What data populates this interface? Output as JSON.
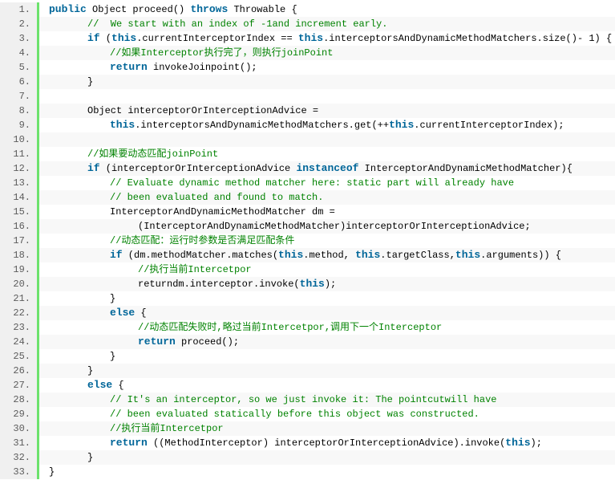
{
  "colors": {
    "keyword": "#006699",
    "comment": "#008200",
    "gutter_border": "#6ce26c",
    "line_number": "#5c5c5c"
  },
  "lines": [
    {
      "n": "1.",
      "indent": 0,
      "tokens": [
        [
          "kw",
          "public"
        ],
        [
          "t",
          " Object proceed() "
        ],
        [
          "kw",
          "throws"
        ],
        [
          "t",
          " Throwable {"
        ]
      ]
    },
    {
      "n": "2.",
      "indent": 1,
      "tokens": [
        [
          "cm",
          "//  We start with an index of -1and increment early."
        ]
      ]
    },
    {
      "n": "3.",
      "indent": 1,
      "tokens": [
        [
          "kw",
          "if"
        ],
        [
          "t",
          " ("
        ],
        [
          "kw",
          "this"
        ],
        [
          "t",
          ".currentInterceptorIndex == "
        ],
        [
          "kw",
          "this"
        ],
        [
          "t",
          ".interceptorsAndDynamicMethodMatchers.size()- 1) {"
        ]
      ]
    },
    {
      "n": "4.",
      "indent": 2,
      "tokens": [
        [
          "cm",
          "//如果Interceptor执行完了，则执行joinPoint"
        ]
      ]
    },
    {
      "n": "5.",
      "indent": 2,
      "tokens": [
        [
          "kw",
          "return"
        ],
        [
          "t",
          " invokeJoinpoint();"
        ]
      ]
    },
    {
      "n": "6.",
      "indent": 1,
      "tokens": [
        [
          "t",
          "}"
        ]
      ]
    },
    {
      "n": "7.",
      "indent": 0,
      "tokens": []
    },
    {
      "n": "8.",
      "indent": 1,
      "tokens": [
        [
          "t",
          "Object interceptorOrInterceptionAdvice ="
        ]
      ]
    },
    {
      "n": "9.",
      "indent": 2,
      "tokens": [
        [
          "kw",
          "this"
        ],
        [
          "t",
          ".interceptorsAndDynamicMethodMatchers.get(++"
        ],
        [
          "kw",
          "this"
        ],
        [
          "t",
          ".currentInterceptorIndex);"
        ]
      ]
    },
    {
      "n": "10.",
      "indent": 0,
      "tokens": []
    },
    {
      "n": "11.",
      "indent": 1,
      "tokens": [
        [
          "cm",
          "//如果要动态匹配joinPoint"
        ]
      ]
    },
    {
      "n": "12.",
      "indent": 1,
      "tokens": [
        [
          "kw",
          "if"
        ],
        [
          "t",
          " (interceptorOrInterceptionAdvice "
        ],
        [
          "kw",
          "instanceof"
        ],
        [
          "t",
          " InterceptorAndDynamicMethodMatcher){"
        ]
      ]
    },
    {
      "n": "13.",
      "indent": 2,
      "tokens": [
        [
          "cm",
          "// Evaluate dynamic method matcher here: static part will already have"
        ]
      ]
    },
    {
      "n": "14.",
      "indent": 2,
      "tokens": [
        [
          "cm",
          "// been evaluated and found to match."
        ]
      ]
    },
    {
      "n": "15.",
      "indent": 2,
      "tokens": [
        [
          "t",
          "InterceptorAndDynamicMethodMatcher dm ="
        ]
      ]
    },
    {
      "n": "16.",
      "indent": 3,
      "tokens": [
        [
          "t",
          "(InterceptorAndDynamicMethodMatcher)interceptorOrInterceptionAdvice;"
        ]
      ]
    },
    {
      "n": "17.",
      "indent": 2,
      "tokens": [
        [
          "cm",
          "//动态匹配：运行时参数是否满足匹配条件"
        ]
      ]
    },
    {
      "n": "18.",
      "indent": 2,
      "tokens": [
        [
          "kw",
          "if"
        ],
        [
          "t",
          " (dm.methodMatcher.matches("
        ],
        [
          "kw",
          "this"
        ],
        [
          "t",
          ".method, "
        ],
        [
          "kw",
          "this"
        ],
        [
          "t",
          ".targetClass,"
        ],
        [
          "kw",
          "this"
        ],
        [
          "t",
          ".arguments)) {"
        ]
      ]
    },
    {
      "n": "19.",
      "indent": 3,
      "tokens": [
        [
          "cm",
          "//执行当前Intercetpor"
        ]
      ]
    },
    {
      "n": "20.",
      "indent": 3,
      "tokens": [
        [
          "t",
          "returndm.interceptor.invoke("
        ],
        [
          "kw",
          "this"
        ],
        [
          "t",
          ");"
        ]
      ]
    },
    {
      "n": "21.",
      "indent": 2,
      "tokens": [
        [
          "t",
          "}"
        ]
      ]
    },
    {
      "n": "22.",
      "indent": 2,
      "tokens": [
        [
          "kw",
          "else"
        ],
        [
          "t",
          " {"
        ]
      ]
    },
    {
      "n": "23.",
      "indent": 3,
      "tokens": [
        [
          "cm",
          "//动态匹配失败时,略过当前Intercetpor,调用下一个Interceptor"
        ]
      ]
    },
    {
      "n": "24.",
      "indent": 3,
      "tokens": [
        [
          "kw",
          "return"
        ],
        [
          "t",
          " proceed();"
        ]
      ]
    },
    {
      "n": "25.",
      "indent": 2,
      "tokens": [
        [
          "t",
          "}"
        ]
      ]
    },
    {
      "n": "26.",
      "indent": 1,
      "tokens": [
        [
          "t",
          "}"
        ]
      ]
    },
    {
      "n": "27.",
      "indent": 1,
      "tokens": [
        [
          "kw",
          "else"
        ],
        [
          "t",
          " {"
        ]
      ]
    },
    {
      "n": "28.",
      "indent": 2,
      "tokens": [
        [
          "cm",
          "// It's an interceptor, so we just invoke it: The pointcutwill have"
        ]
      ]
    },
    {
      "n": "29.",
      "indent": 2,
      "tokens": [
        [
          "cm",
          "// been evaluated statically before this object was constructed."
        ]
      ]
    },
    {
      "n": "30.",
      "indent": 2,
      "tokens": [
        [
          "cm",
          "//执行当前Intercetpor"
        ]
      ]
    },
    {
      "n": "31.",
      "indent": 2,
      "tokens": [
        [
          "kw",
          "return"
        ],
        [
          "t",
          " ((MethodInterceptor) interceptorOrInterceptionAdvice).invoke("
        ],
        [
          "kw",
          "this"
        ],
        [
          "t",
          ");"
        ]
      ]
    },
    {
      "n": "32.",
      "indent": 1,
      "tokens": [
        [
          "t",
          "}"
        ]
      ]
    },
    {
      "n": "33.",
      "indent": 0,
      "tokens": [
        [
          "t",
          "}"
        ]
      ]
    }
  ]
}
